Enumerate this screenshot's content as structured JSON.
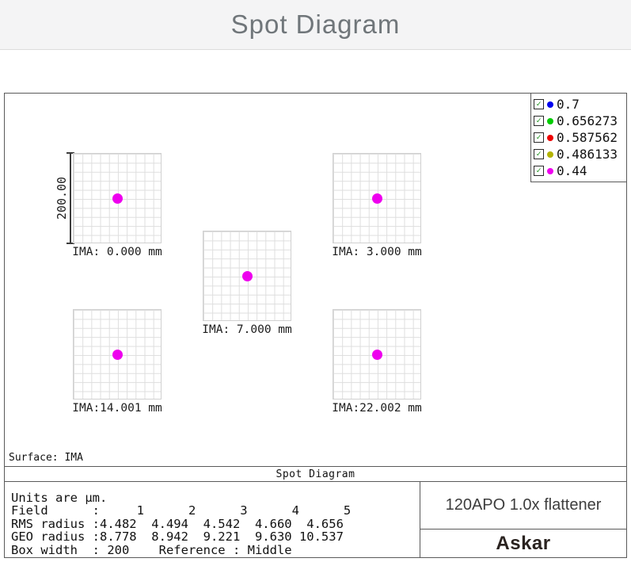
{
  "page": {
    "title": "Spot Diagram"
  },
  "legend": {
    "items": [
      {
        "label": "0.7",
        "color": "#0000EE",
        "dot_style": "background:#0000EE"
      },
      {
        "label": "0.656273",
        "color": "#00CC00",
        "dot_style": "background:#00CC00"
      },
      {
        "label": "0.587562",
        "color": "#EE0000",
        "dot_style": "background:#EE0000"
      },
      {
        "label": "0.486133",
        "color": "#B3B300",
        "dot_style": "background:#B3B300"
      },
      {
        "label": "0.44",
        "color": "#EE00EE",
        "dot_style": "background:#EE00EE"
      }
    ]
  },
  "axis": {
    "scale_label": "200.00"
  },
  "panels": [
    {
      "ima_label": "IMA: 0.000 mm"
    },
    {
      "ima_label": "IMA: 3.000 mm"
    },
    {
      "ima_label": "IMA: 7.000 mm"
    },
    {
      "ima_label": "IMA:14.001 mm"
    },
    {
      "ima_label": "IMA:22.002 mm"
    }
  ],
  "plot_footer": {
    "surface_label": "Surface: IMA",
    "band_title": "Spot Diagram"
  },
  "stats": {
    "lines": [
      "Units are µm.",
      "Field      :     1      2      3      4      5",
      "RMS radius :4.482  4.494  4.542  4.660  4.656",
      "GEO radius :8.778  8.942  9.221  9.630 10.537",
      "Box width  : 200    Reference : Middle"
    ]
  },
  "title_block": {
    "product": "120APO 1.0x flattener",
    "brand": "Askar"
  },
  "chart_data": {
    "type": "scatter",
    "title": "Spot Diagram",
    "surface": "IMA",
    "units": "µm",
    "box_width_um": 200,
    "scale_bar_label": "200.00",
    "reference": "Middle",
    "wavelengths_um": [
      0.7,
      0.656273,
      0.587562,
      0.486133,
      0.44
    ],
    "wavelength_colors": [
      "#0000EE",
      "#00CC00",
      "#EE0000",
      "#B3B300",
      "#EE00EE"
    ],
    "visible_spot_color": "#EE00EE",
    "grid_cells": 10,
    "fields": [
      {
        "field": 1,
        "ima_mm": 0.0,
        "ima_label": "IMA: 0.000 mm",
        "rms_radius_um": 4.482,
        "geo_radius_um": 8.778,
        "spot_xy_um": [
          0,
          0
        ]
      },
      {
        "field": 2,
        "ima_mm": 3.0,
        "ima_label": "IMA: 3.000 mm",
        "rms_radius_um": 4.494,
        "geo_radius_um": 8.942,
        "spot_xy_um": [
          0,
          0
        ]
      },
      {
        "field": 3,
        "ima_mm": 7.0,
        "ima_label": "IMA: 7.000 mm",
        "rms_radius_um": 4.542,
        "geo_radius_um": 9.221,
        "spot_xy_um": [
          0,
          0
        ]
      },
      {
        "field": 4,
        "ima_mm": 14.001,
        "ima_label": "IMA:14.001 mm",
        "rms_radius_um": 4.66,
        "geo_radius_um": 9.63,
        "spot_xy_um": [
          0,
          0
        ]
      },
      {
        "field": 5,
        "ima_mm": 22.002,
        "ima_label": "IMA:22.002 mm",
        "rms_radius_um": 4.656,
        "geo_radius_um": 10.537,
        "spot_xy_um": [
          0,
          0
        ]
      }
    ]
  }
}
